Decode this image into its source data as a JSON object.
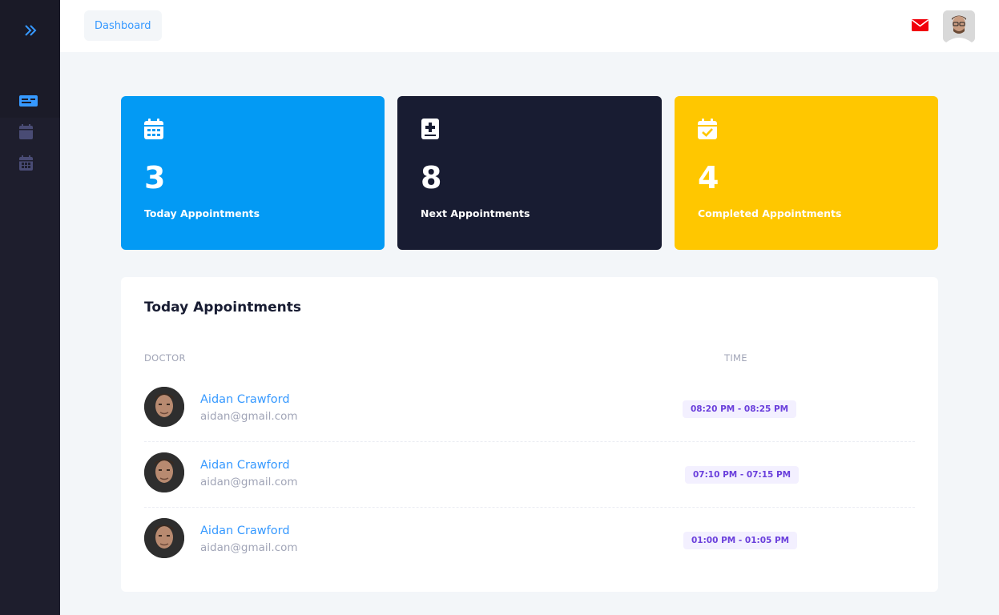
{
  "sidebar": {
    "toggle_icon": "double-chevron-right-icon",
    "items": [
      {
        "icon": "id-card-icon",
        "active": true
      },
      {
        "icon": "calendar-icon",
        "active": false
      },
      {
        "icon": "calendar-grid-icon",
        "active": false
      }
    ]
  },
  "header": {
    "breadcrumb": "Dashboard",
    "mail_icon": "envelope-icon",
    "mail_color": "#f1000b"
  },
  "stats": [
    {
      "value": "3",
      "label": "Today Appointments",
      "icon": "calendar-grid-icon",
      "color": "#039af4"
    },
    {
      "value": "8",
      "label": "Next Appointments",
      "icon": "medical-book-icon",
      "color": "#181c32"
    },
    {
      "value": "4",
      "label": "Completed Appointments",
      "icon": "calendar-check-icon",
      "color": "#ffc700"
    }
  ],
  "appointments": {
    "title": "Today Appointments",
    "columns": {
      "doctor": "DOCTOR",
      "time": "TIME"
    },
    "rows": [
      {
        "name": "Aidan Crawford",
        "email": "aidan@gmail.com",
        "time": "08:20 PM - 08:25 PM"
      },
      {
        "name": "Aidan Crawford",
        "email": "aidan@gmail.com",
        "time": "07:10 PM - 07:15 PM"
      },
      {
        "name": "Aidan Crawford",
        "email": "aidan@gmail.com",
        "time": "01:00 PM - 01:05 PM"
      }
    ]
  }
}
